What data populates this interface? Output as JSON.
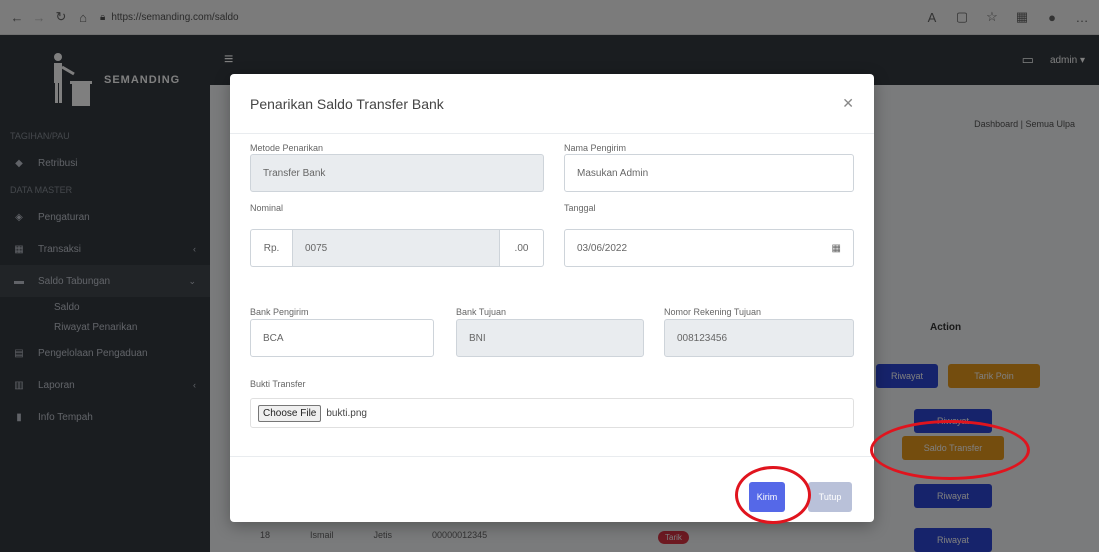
{
  "browser": {
    "url": "https://semanding.com/saldo"
  },
  "app": {
    "brand": "SEMANDING",
    "user": "admin",
    "breadcrumb": "Dashboard  |  Semua Ulpa",
    "sidebar": {
      "header1": "TAGIHAN/PAU",
      "item1": "Retribusi",
      "header2": "DATA MASTER",
      "item2": "Pengaturan",
      "item3": "Transaksi",
      "item4": "Saldo Tabungan",
      "sub1": "Saldo",
      "sub2": "Riwayat Penarikan",
      "item5": "Pengelolaan Pengaduan",
      "item6": "Laporan",
      "item7": "Info Tempah"
    },
    "bg": {
      "action_head": "Action",
      "btn_riwayat": "Riwayat",
      "btn_tarik_poin": "Tarik Poin",
      "btn_saldo_transfer": "Saldo Transfer",
      "row_no": "18",
      "row_name": "Ismail",
      "row_addr": "Jetis",
      "row_code": "00000012345",
      "row_badge": "Tarik"
    }
  },
  "modal": {
    "title": "Penarikan Saldo Transfer Bank",
    "metode_label": "Metode Penarikan",
    "metode_value": "Transfer Bank",
    "pengirim_label": "Nama Pengirim",
    "pengirim_value": "Masukan Admin",
    "nominal_label": "Nominal",
    "nominal_prefix": "Rp.",
    "nominal_value": "0075",
    "nominal_suffix": ".00",
    "tanggal_label": "Tanggal",
    "tanggal_value": "03/06/2022",
    "bank_pengirim_label": "Bank Pengirim",
    "bank_pengirim_value": "BCA",
    "bank_tujuan_label": "Bank Tujuan",
    "bank_tujuan_value": "BNI",
    "rekening_label": "Nomor Rekening Tujuan",
    "rekening_value": "008123456",
    "bukti_label": "Bukti Transfer",
    "choose_file": "Choose File",
    "file_name": "bukti.png",
    "btn_send": "Kirim",
    "btn_cancel": "Tutup"
  }
}
